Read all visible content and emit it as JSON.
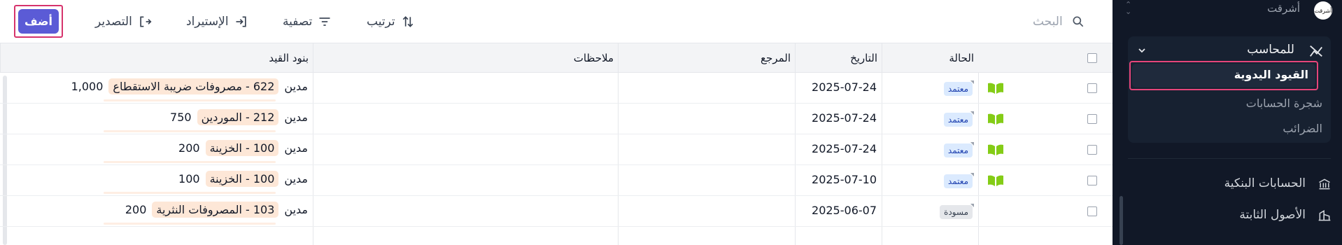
{
  "toolbar": {
    "add_label": "أضف",
    "export_label": "التصدير",
    "import_label": "الإستيراد",
    "filter_label": "تصفية",
    "sort_label": "ترتيب",
    "search_placeholder": "البحث"
  },
  "table": {
    "columns": {
      "status": "الحالة",
      "date": "التاريخ",
      "reference": "المرجع",
      "notes": "ملاحظات",
      "entries": "بنود القيد"
    },
    "rows": [
      {
        "status": "معتمد",
        "status_type": "approved",
        "date": "2025-07-24",
        "reference": "",
        "notes": "",
        "side": "مدين",
        "account": "622 - مصروفات ضريبة الاستقطاع",
        "amount": "1,000"
      },
      {
        "status": "معتمد",
        "status_type": "approved",
        "date": "2025-07-24",
        "reference": "",
        "notes": "",
        "side": "مدين",
        "account": "212 - الموردين",
        "amount": "750"
      },
      {
        "status": "معتمد",
        "status_type": "approved",
        "date": "2025-07-24",
        "reference": "",
        "notes": "",
        "side": "مدين",
        "account": "100 - الخزينة",
        "amount": "200"
      },
      {
        "status": "معتمد",
        "status_type": "approved",
        "date": "2025-07-10",
        "reference": "",
        "notes": "",
        "side": "مدين",
        "account": "100 - الخزينة",
        "amount": "100"
      },
      {
        "status": "مسودة",
        "status_type": "draft",
        "date": "2025-06-07",
        "reference": "",
        "notes": "",
        "side": "مدين",
        "account": "103 - المصروفات النثرية",
        "amount": "200"
      }
    ]
  },
  "sidebar": {
    "org_name": "أشرقت",
    "org_logo_text": "أشرقت",
    "group": {
      "title": "للمحاسب",
      "items": [
        "القيود اليدوية",
        "شجرة الحسابات",
        "الضرائب"
      ]
    },
    "nav": [
      "الحسابات البنكية",
      "الأصول الثابتة"
    ]
  },
  "colors": {
    "accent": "#5b5bd6",
    "highlight_border": "#d6336c",
    "sidebar_bg": "#111827",
    "approved_badge": "#dbeafe",
    "entry_tag": "#fde7d7",
    "book_icon": "#84cc16"
  }
}
